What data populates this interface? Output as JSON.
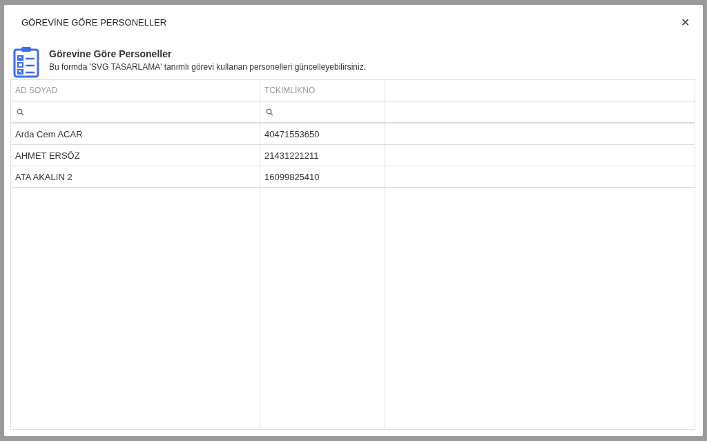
{
  "dialog": {
    "title": "GÖREVİNE GÖRE PERSONELLER",
    "close": "✕"
  },
  "header": {
    "title": "Görevine Göre Personeller",
    "description": "Bu formda 'SVG TASARLAMA' tanımlı görevi kullanan personelleri güncelleyebilirsiniz."
  },
  "table": {
    "columns": [
      "AD SOYAD",
      "TCKİMLİKNO"
    ],
    "rows": [
      [
        "Arda Cem ACAR",
        "40471553650"
      ],
      [
        "AHMET ERSÖZ",
        "21431221211"
      ],
      [
        "ATA AKALIN 2",
        "16099825410"
      ]
    ]
  }
}
